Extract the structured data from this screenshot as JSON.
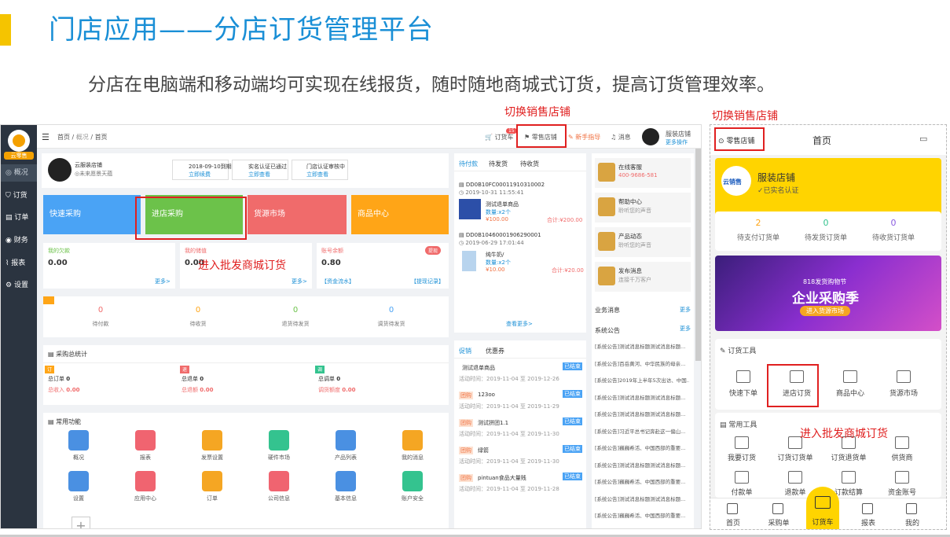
{
  "slide": {
    "title": "门店应用——分店订货管理平台",
    "subtitle": "分店在电脑端和移动端均可实现在线报货，随时随地商城式订货，提高订货管理效率。",
    "annot_switch_desktop": "切换销售店铺",
    "annot_switch_mobile": "切换销售店铺",
    "annot_wholesale_desktop": "进入批发商城订货",
    "annot_wholesale_mobile": "进入批发商城订货"
  },
  "desktop": {
    "sidebar": {
      "brand": "云零售",
      "items": [
        "概况",
        "订货",
        "订单",
        "财务",
        "报表",
        "设置"
      ]
    },
    "topbar": {
      "breadcrumb": [
        "首页",
        "概况",
        "首页"
      ],
      "cart": "订货车",
      "cart_badge": "15",
      "store": "零售店铺",
      "guide": "新手指导",
      "msg": "消息",
      "shop_name": "服装店铺",
      "more_store": "更多操作"
    },
    "profile": {
      "name": "云服装店铺",
      "sub": "◎未来愿景天蕴",
      "expire": "2018-09-10到期",
      "renew": "立即续费",
      "verify": "实名认证已通过",
      "verify_link": "立即查看",
      "store_verify": "门店认证审核中",
      "store_link": "立即查看"
    },
    "quick": [
      "快速采购",
      "进店采购",
      "货源市场",
      "商品中心"
    ],
    "finance": [
      {
        "label": "我的欠款",
        "value": "0.00",
        "link": "更多>"
      },
      {
        "label": "我的储值",
        "value": "0.00",
        "link": "更多>"
      },
      {
        "label": "账号余额",
        "value": "0.80",
        "link1": "【资金流水】",
        "link2": "【提现记录】",
        "badge": "提现"
      }
    ],
    "counts": [
      {
        "num": "0",
        "label": "待付款"
      },
      {
        "num": "0",
        "label": "待收货"
      },
      {
        "num": "0",
        "label": "退货待发货"
      },
      {
        "num": "0",
        "label": "调货待发货"
      }
    ],
    "stats": {
      "title": "采购总统计",
      "items": [
        {
          "tag": "订",
          "l1": "总订单",
          "v1": "0",
          "l2": "总收入",
          "v2": "0.00"
        },
        {
          "tag": "退",
          "l1": "总退单",
          "v1": "0",
          "l2": "总退额",
          "v2": "0.00"
        },
        {
          "tag": "调",
          "l1": "总调单",
          "v1": "0",
          "l2": "调货额度",
          "v2": "0.00"
        }
      ]
    },
    "funcs": {
      "title": "常用功能",
      "items": [
        {
          "label": "概况",
          "color": "#4a90e2"
        },
        {
          "label": "报表",
          "color": "#f06470"
        },
        {
          "label": "发票设置",
          "color": "#f5a623"
        },
        {
          "label": "硬件市场",
          "color": "#34c38f"
        },
        {
          "label": "产品列表",
          "color": "#4a90e2"
        },
        {
          "label": "我的消息",
          "color": "#f5a623"
        },
        {
          "label": "设置",
          "color": "#4a90e2"
        },
        {
          "label": "应用中心",
          "color": "#f06470"
        },
        {
          "label": "订单",
          "color": "#f5a623"
        },
        {
          "label": "公司信息",
          "color": "#f06470"
        },
        {
          "label": "基本信息",
          "color": "#4a90e2"
        },
        {
          "label": "账户安全",
          "color": "#34c38f"
        }
      ]
    },
    "orders": {
      "tabs": [
        "待付款",
        "待发货",
        "待收货"
      ],
      "list": [
        {
          "no": "DD0B10FC00011910310002",
          "time": "2019-10-31 11:55:41",
          "item": "测试退单商品",
          "qty": "数量:x2个",
          "price": "¥100.00",
          "total": "合计:¥200.00"
        },
        {
          "no": "DD0B10460001906290001",
          "time": "2019-06-29 17:01:44",
          "item": "纯牛奶/",
          "qty": "数量:x2个",
          "price": "¥10.00",
          "total": "合计:¥20.00"
        }
      ],
      "more": "查看更多>"
    },
    "promos": {
      "tabs": [
        "促销",
        "优惠券"
      ],
      "list": [
        {
          "tag": "",
          "name": "测试退单商品",
          "time": "活动时间：2019-11-04 至 2019-12-26",
          "status": "已结束"
        },
        {
          "tag": "团购",
          "name": "123oo",
          "time": "活动时间：2019-11-04 至 2019-11-29",
          "status": "已结束"
        },
        {
          "tag": "团购",
          "name": "测试拼团1.1",
          "time": "活动时间：2019-11-04 至 2019-11-30",
          "status": "已结束"
        },
        {
          "tag": "团购",
          "name": "绿箭",
          "time": "活动时间：2019-11-04 至 2019-11-30",
          "status": "已结束"
        },
        {
          "tag": "团购",
          "name": "pintuan食品大量贱",
          "time": "活动时间：2019-11-04 至 2019-11-28",
          "status": "已结束"
        }
      ]
    },
    "service": [
      {
        "t": "在线客服",
        "s": "400-9686-581"
      },
      {
        "t": "帮助中心",
        "s": "聆听您的声音"
      },
      {
        "t": "产品动态",
        "s": "聆听您的声音"
      },
      {
        "t": "发布消息",
        "s": "连接千万客户"
      }
    ],
    "biz_msg": "业务消息",
    "sys_notice": "系统公告",
    "more": "更多",
    "notices": [
      "[系统公告]测试消息标题测试消息标题...",
      "[系统公告]百岳黄河、中华民族的母亲...",
      "[系统公告]2019年上半年5次出访、中国...",
      "[系统公告]测试消息标题测试消息标题...",
      "[系统公告]测试消息标题测试消息标题...",
      "[系统公告]习近平总书记奔赴这一偏山...",
      "[系统公告]巍巍希活、中国西部的重要...",
      "[系统公告]测试消息标题测试消息标题...",
      "[系统公告]巍巍希活、中国西部的重要...",
      "[系统公告]测试消息标题测试消息标题...",
      "[系统公告]巍巍希活、中国西部的重要...",
      "[系统公告]巍巍希活、中国西部的重要..."
    ]
  },
  "mobile": {
    "store": "零售店铺",
    "title": "首页",
    "shop": "服装店铺",
    "verified": "已实名认证",
    "brand": "云销售",
    "stats": [
      {
        "num": "2",
        "label": "待支付订货单"
      },
      {
        "num": "0",
        "label": "待发货订货单"
      },
      {
        "num": "0",
        "label": "待收货订货单"
      }
    ],
    "banner": {
      "top": "818发货购物节",
      "main": "企业采购季",
      "btn": "进入货源市场"
    },
    "order_tools": {
      "title": "订货工具",
      "items": [
        "快速下单",
        "进店订货",
        "商品中心",
        "货源市场"
      ]
    },
    "common_tools": {
      "title": "常用工具",
      "row1": [
        "我要订货",
        "订货订货单",
        "订货退货单",
        "供货商"
      ],
      "row2": [
        "付款单",
        "退款单",
        "订款结算",
        "资金账号"
      ]
    },
    "tabs": [
      "首页",
      "采购单",
      "订货车",
      "报表",
      "我的"
    ]
  }
}
